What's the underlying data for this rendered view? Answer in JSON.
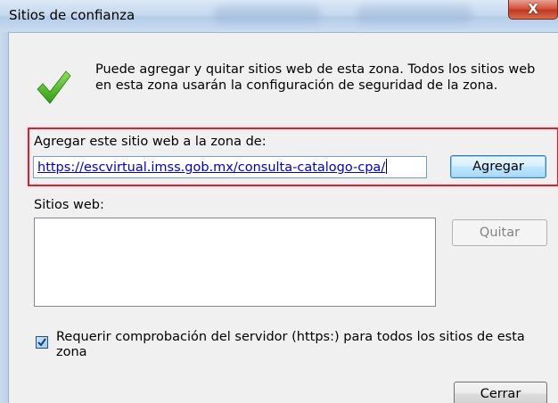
{
  "window": {
    "title": "Sitios de confianza",
    "close_glyph": "X"
  },
  "info": {
    "icon": "check-icon",
    "message": "Puede agregar y quitar sitios web de esta zona. Todos los sitios web en esta zona usarán la configuración de seguridad de la zona."
  },
  "add_site": {
    "label": "Agregar este sitio web a la zona de:",
    "url_value": "https://escvirtual.imss.gob.mx/consulta-catalogo-cpa/",
    "add_button": "Agregar"
  },
  "websites": {
    "label": "Sitios web:",
    "items": [],
    "remove_button": "Quitar"
  },
  "https_requirement": {
    "checked": true,
    "label": "Requerir comprobación del servidor (https:) para todos los sitios de esta zona"
  },
  "footer": {
    "close_button": "Cerrar"
  },
  "colors": {
    "highlight_border": "#e8192c",
    "check_green": "#4caf22",
    "url_text": "#0000cc"
  }
}
